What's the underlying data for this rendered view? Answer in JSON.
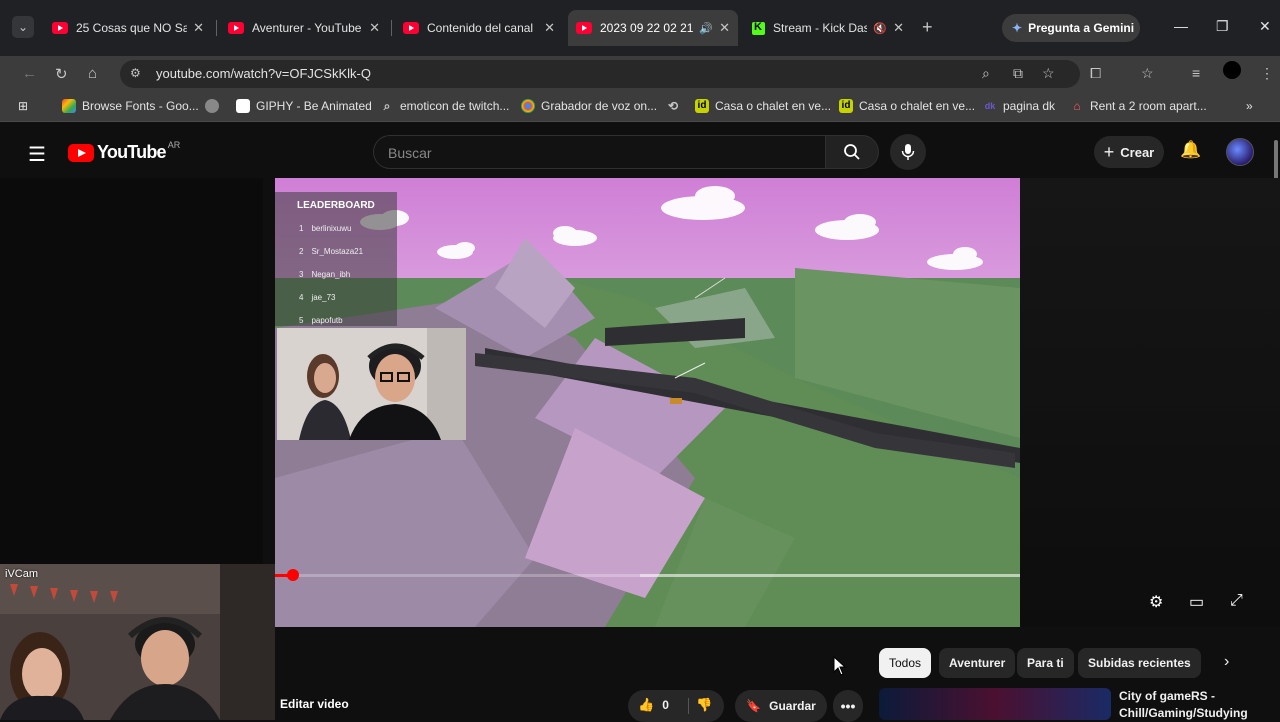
{
  "browser": {
    "tabs": [
      {
        "title": "25 Cosas que NO Sab",
        "favicon": "youtube-icon",
        "active": false
      },
      {
        "title": "Aventurer - YouTube",
        "favicon": "youtube-icon",
        "active": false
      },
      {
        "title": "Contenido del canal",
        "favicon": "youtube-icon",
        "active": false
      },
      {
        "title": "2023 09 22 02 21",
        "favicon": "youtube-icon",
        "active": true,
        "audio": true
      },
      {
        "title": "Stream - Kick Das",
        "favicon": "kick-icon",
        "active": false,
        "muted": true
      }
    ],
    "gemini_label": "Pregunta a Gemini",
    "url": "youtube.com/watch?v=OFJCSkKlk-Q",
    "bookmarks": [
      {
        "label": "Browse Fonts - Goo..."
      },
      {
        "label": ""
      },
      {
        "label": "GIPHY - Be Animated"
      },
      {
        "label": "emoticon de twitch..."
      },
      {
        "label": "Grabador de voz on..."
      },
      {
        "label": ""
      },
      {
        "label": "Casa o chalet en ve..."
      },
      {
        "label": "Casa o chalet en ve..."
      },
      {
        "label": "pagina dk"
      },
      {
        "label": "Rent a 2 room apart..."
      }
    ]
  },
  "youtube": {
    "logo_text": "YouTube",
    "logo_country": "AR",
    "search_placeholder": "Buscar",
    "create_label": "Crear"
  },
  "player": {
    "leaderboard_title": "LEADERBOARD",
    "leaderboard": [
      {
        "rank": "1",
        "name": "berlinixuwu"
      },
      {
        "rank": "2",
        "name": "Sr_Mostaza21"
      },
      {
        "rank": "3",
        "name": "Negan_ibh"
      },
      {
        "rank": "4",
        "name": "jae_73"
      },
      {
        "rank": "5",
        "name": "papofutb"
      }
    ],
    "progress_fraction": 0.024,
    "buffer_fraction": 0.51
  },
  "overlay_cam_label": "iVCam",
  "actions": {
    "edit_label": "Editar video",
    "like_count": "0",
    "save_label": "Guardar"
  },
  "chips": [
    {
      "label": "Todos",
      "selected": true
    },
    {
      "label": "Aventurer",
      "selected": false
    },
    {
      "label": "Para ti",
      "selected": false
    },
    {
      "label": "Subidas recientes",
      "selected": false
    }
  ],
  "recommendation": {
    "title": "City of gameRS - Chill/Gaming/Studying"
  },
  "colors": {
    "yt_red": "#ff0000",
    "bg": "#0f0f0f",
    "chip_bg": "#272727",
    "sky_pink": "#d88ad8",
    "grass": "#5f8a5a"
  }
}
